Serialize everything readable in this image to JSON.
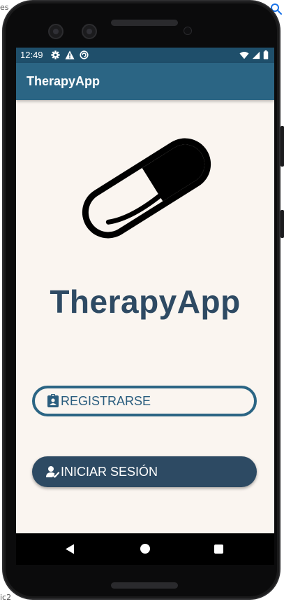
{
  "background": {
    "top_left_fragment": "es",
    "left_mid_fragment": "ic2"
  },
  "status_bar": {
    "time": "12:49",
    "left_icons": [
      "gear-icon",
      "alert-triangle-icon",
      "sync-circle-icon"
    ],
    "right_icons": [
      "wifi-icon",
      "signal-icon",
      "battery-icon"
    ]
  },
  "app_bar": {
    "title": "TherapyApp"
  },
  "main": {
    "logo_icon": "pill-capsule-icon",
    "app_name": "TherapyApp",
    "register_button": {
      "label": "REGISTRARSE",
      "icon": "id-badge-icon"
    },
    "login_button": {
      "label": "INICIAR SESIÓN",
      "icon": "person-check-icon"
    }
  },
  "nav_bar": {
    "buttons": [
      "back-icon",
      "home-icon",
      "recents-icon"
    ]
  },
  "colors": {
    "status_bar": "#1f4f6b",
    "app_bar": "#2b6584",
    "screen_bg": "#faf5f0",
    "title_text": "#2e4a63",
    "register_border": "#2b6584",
    "login_bg": "#2d4a63"
  }
}
